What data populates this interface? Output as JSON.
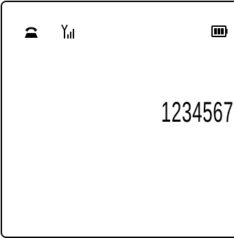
{
  "status_bar": {
    "call_icon": "handset-icon",
    "signal_icon": "signal-strength-icon",
    "battery_icon": "battery-icon"
  },
  "display": {
    "number": "1234567"
  }
}
